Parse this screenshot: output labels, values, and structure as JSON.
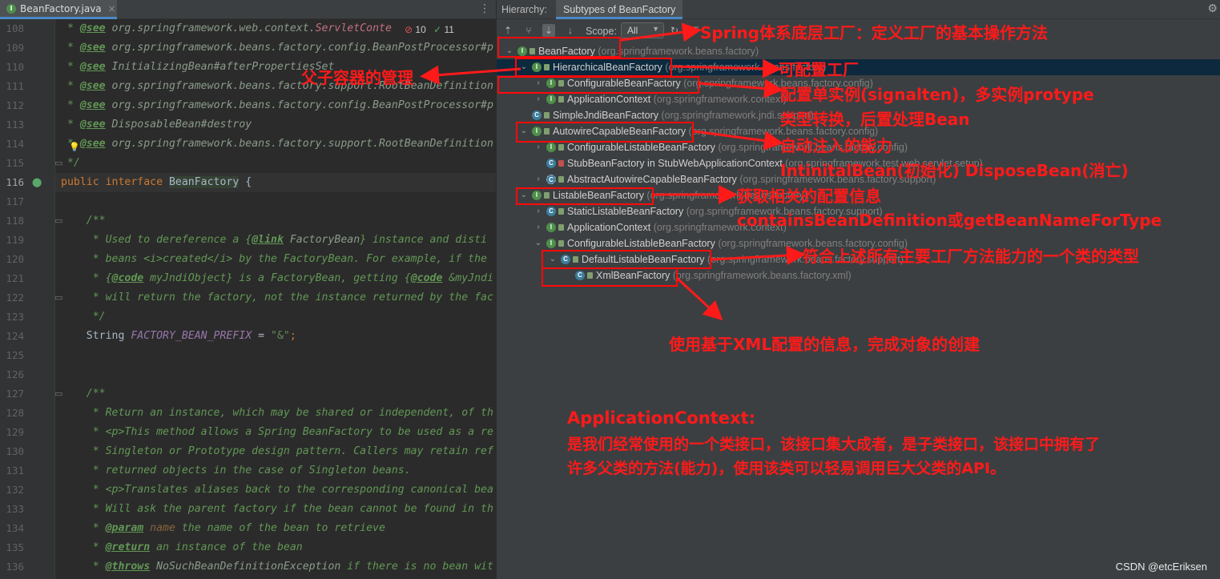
{
  "editor": {
    "tab_name": "BeanFactory.java",
    "tab_close": "×",
    "menu_dots": "⋮",
    "inspection_errors": "10",
    "inspection_warnings": "11",
    "lines": [
      {
        "no": "108",
        "parts": [
          {
            "t": " * ",
            "c": "cm"
          },
          {
            "t": "@see",
            "c": "tag"
          },
          {
            "t": " org.springframework.web.context.",
            "c": "ref"
          },
          {
            "t": "ServletConte",
            "c": "pink"
          }
        ]
      },
      {
        "no": "109",
        "parts": [
          {
            "t": " * ",
            "c": "cm"
          },
          {
            "t": "@see",
            "c": "tag"
          },
          {
            "t": " org.springframework.beans.factory.config.BeanPostProcessor#p",
            "c": "ref"
          }
        ]
      },
      {
        "no": "110",
        "parts": [
          {
            "t": " * ",
            "c": "cm"
          },
          {
            "t": "@see",
            "c": "tag"
          },
          {
            "t": " InitializingBean#afterPropertiesSet",
            "c": "ref"
          }
        ]
      },
      {
        "no": "111",
        "parts": [
          {
            "t": " * ",
            "c": "cm"
          },
          {
            "t": "@see",
            "c": "tag"
          },
          {
            "t": " org.springframework.beans.factory.support.RootBeanDefinition",
            "c": "ref"
          }
        ]
      },
      {
        "no": "112",
        "parts": [
          {
            "t": " * ",
            "c": "cm"
          },
          {
            "t": "@see",
            "c": "tag"
          },
          {
            "t": " org.springframework.beans.factory.config.BeanPostProcessor#p",
            "c": "ref"
          }
        ]
      },
      {
        "no": "113",
        "parts": [
          {
            "t": " * ",
            "c": "cm"
          },
          {
            "t": "@see",
            "c": "tag"
          },
          {
            "t": " DisposableBean#destroy",
            "c": "ref"
          }
        ]
      },
      {
        "no": "114",
        "parts": [
          {
            "t": " * ",
            "c": "cm"
          },
          {
            "t": "@see",
            "c": "tag"
          },
          {
            "t": " org.springframework.beans.factory.support.RootBeanDefinition",
            "c": "ref"
          }
        ]
      },
      {
        "no": "115",
        "parts": [
          {
            "t": " */",
            "c": "cm"
          }
        ]
      },
      {
        "no": "116",
        "parts": [
          {
            "t": "public interface ",
            "c": "kw"
          },
          {
            "t": "BeanFactory",
            "c": "cls"
          },
          {
            "t": " {",
            "c": ""
          }
        ]
      },
      {
        "no": "117",
        "parts": []
      },
      {
        "no": "118",
        "parts": [
          {
            "t": "    /**",
            "c": "cm"
          }
        ]
      },
      {
        "no": "119",
        "parts": [
          {
            "t": "     * Used to dereference a {",
            "c": "cm"
          },
          {
            "t": "@link",
            "c": "tag"
          },
          {
            "t": " FactoryBean",
            "c": "ref"
          },
          {
            "t": "} instance and disti",
            "c": "cm"
          }
        ]
      },
      {
        "no": "120",
        "parts": [
          {
            "t": "     * beans <i>created</i> by the FactoryBean. For example, if the",
            "c": "cm"
          }
        ]
      },
      {
        "no": "121",
        "parts": [
          {
            "t": "     * {",
            "c": "cm"
          },
          {
            "t": "@code",
            "c": "tag"
          },
          {
            "t": " myJndiObject} is a FactoryBean, getting {",
            "c": "cm"
          },
          {
            "t": "@code",
            "c": "tag"
          },
          {
            "t": " &myJndi",
            "c": "cm"
          }
        ]
      },
      {
        "no": "122",
        "parts": [
          {
            "t": "     * will return the factory, not the instance returned by the fac",
            "c": "cm"
          }
        ]
      },
      {
        "no": "123",
        "parts": [
          {
            "t": "     */",
            "c": "cm"
          }
        ]
      },
      {
        "no": "124",
        "parts": [
          {
            "t": "    String ",
            "c": ""
          },
          {
            "t": "FACTORY_BEAN_PREFIX",
            "c": "cst"
          },
          {
            "t": " = ",
            "c": ""
          },
          {
            "t": "\"&\"",
            "c": "str"
          },
          {
            "t": ";",
            "c": "kw"
          }
        ]
      },
      {
        "no": "125",
        "parts": []
      },
      {
        "no": "126",
        "parts": []
      },
      {
        "no": "127",
        "parts": [
          {
            "t": "    /**",
            "c": "cm"
          }
        ]
      },
      {
        "no": "128",
        "parts": [
          {
            "t": "     * Return an instance, which may be shared or independent, of th",
            "c": "cm"
          }
        ]
      },
      {
        "no": "129",
        "parts": [
          {
            "t": "     * <p>This method allows a Spring BeanFactory to be used as a re",
            "c": "cm"
          }
        ]
      },
      {
        "no": "130",
        "parts": [
          {
            "t": "     * Singleton or Prototype design pattern. Callers may retain ref",
            "c": "cm"
          }
        ]
      },
      {
        "no": "131",
        "parts": [
          {
            "t": "     * returned objects in the case of Singleton beans.",
            "c": "cm"
          }
        ]
      },
      {
        "no": "132",
        "parts": [
          {
            "t": "     * <p>Translates aliases back to the corresponding canonical bea",
            "c": "cm"
          }
        ]
      },
      {
        "no": "133",
        "parts": [
          {
            "t": "     * Will ask the parent factory if the bean cannot be found in th",
            "c": "cm"
          }
        ]
      },
      {
        "no": "134",
        "parts": [
          {
            "t": "     * ",
            "c": "cm"
          },
          {
            "t": "@param",
            "c": "tag"
          },
          {
            "t": " name",
            "c": "pname"
          },
          {
            "t": " the name of the bean to retrieve",
            "c": "cm"
          }
        ]
      },
      {
        "no": "135",
        "parts": [
          {
            "t": "     * ",
            "c": "cm"
          },
          {
            "t": "@return",
            "c": "tag"
          },
          {
            "t": " an instance of the bean",
            "c": "cm"
          }
        ]
      },
      {
        "no": "136",
        "parts": [
          {
            "t": "     * ",
            "c": "cm"
          },
          {
            "t": "@throws",
            "c": "tag"
          },
          {
            "t": " NoSuchBeanDefinitionException",
            "c": "ref"
          },
          {
            "t": " if there is no bean wit",
            "c": "cm"
          }
        ]
      }
    ]
  },
  "hierarchy": {
    "title": "Hierarchy:",
    "tab": "Subtypes of BeanFactory",
    "scope_label": "Scope:",
    "scope_value": "All",
    "tree": [
      {
        "arrow": "v",
        "icon": "I",
        "kind": "iface",
        "star": "*",
        "name": "BeanFactory",
        "pkg": " (org.springframework.beans.factory)"
      },
      {
        "arrow": "v",
        "icon": "I",
        "kind": "iface",
        "name": "HierarchicalBeanFactory",
        "pkg": " (org.springframework.beans.factory)",
        "selected": true
      },
      {
        "arrow": ">",
        "icon": "I",
        "kind": "iface",
        "name": "ConfigurableBeanFactory",
        "pkg": " (org.springframework.beans.factory.config)"
      },
      {
        "arrow": ">",
        "icon": "I",
        "kind": "iface",
        "name": "ApplicationContext",
        "pkg": " (org.springframework.context)"
      },
      {
        "arrow": "",
        "icon": "C",
        "kind": "klass",
        "name": "SimpleJndiBeanFactory",
        "pkg": " (org.springframework.jndi.support)"
      },
      {
        "arrow": "v",
        "icon": "I",
        "kind": "iface",
        "name": "AutowireCapableBeanFactory",
        "pkg": " (org.springframework.beans.factory.config)"
      },
      {
        "arrow": ">",
        "icon": "I",
        "kind": "iface",
        "name": "ConfigurableListableBeanFactory",
        "pkg": " (org.springframework.beans.factory.config)"
      },
      {
        "arrow": "",
        "icon": "C",
        "kind": "klass",
        "name": "StubBeanFactory in StubWebApplicationContext",
        "pkg": " (org.springframework.test.web.servlet.setup)",
        "lock": "red"
      },
      {
        "arrow": ">",
        "icon": "C",
        "kind": "abs",
        "name": "AbstractAutowireCapableBeanFactory",
        "pkg": " (org.springframework.beans.factory.support)"
      },
      {
        "arrow": "v",
        "icon": "I",
        "kind": "iface",
        "name": "ListableBeanFactory",
        "pkg": " (org.springframework.beans.factory)"
      },
      {
        "arrow": ">",
        "icon": "C",
        "kind": "klass",
        "name": "StaticListableBeanFactory",
        "pkg": " (org.springframework.beans.factory.support)"
      },
      {
        "arrow": ">",
        "icon": "I",
        "kind": "iface",
        "name": "ApplicationContext",
        "pkg": " (org.springframework.context)"
      },
      {
        "arrow": "v",
        "icon": "I",
        "kind": "iface",
        "name": "ConfigurableListableBeanFactory",
        "pkg": " (org.springframework.beans.factory.config)"
      },
      {
        "arrow": "v",
        "icon": "C",
        "kind": "klass",
        "name": "DefaultListableBeanFactory",
        "pkg": " (org.springframework.beans.factory.support)"
      },
      {
        "arrow": "",
        "icon": "C",
        "kind": "klass",
        "name": "XmlBeanFactory",
        "pkg": " (org.springframework.beans.factory.xml)"
      }
    ]
  },
  "annotations": {
    "spring_base": "Spring体系底层工厂：定义工厂的基本操作方法",
    "parent_container": "父子容器的管理",
    "configurable": "可配置工厂",
    "singleton_prototype": "配置单实例(signalten)，多实例protype",
    "type_convert": "类型转换，后置处理Bean",
    "autowire": "自动注入的能力",
    "init_dispose": "IntinitalBean(初始化) DisposeBean(消亡)",
    "listable": "获取相关的配置信息",
    "contains_def": "containsBeanDefinition或getBeanNameForType",
    "default_listable": "符合上述所有主要工厂方法能力的一个类的类型",
    "xml_info": "使用基于XML配置的信息，完成对象的创建",
    "app_ctx_title": "ApplicationContext:",
    "app_ctx_line1": "是我们经常使用的一个类接口，该接口集大成者，是子类接口，该接口中拥有了",
    "app_ctx_line2": "许多父类的方法(能力)，使用该类可以轻易调用巨大父类的API。"
  },
  "watermark": "CSDN @etcEriksen",
  "colors": {
    "annotation": "#ff1a1a",
    "accent": "#4a88c7",
    "selection": "#0d293e"
  }
}
